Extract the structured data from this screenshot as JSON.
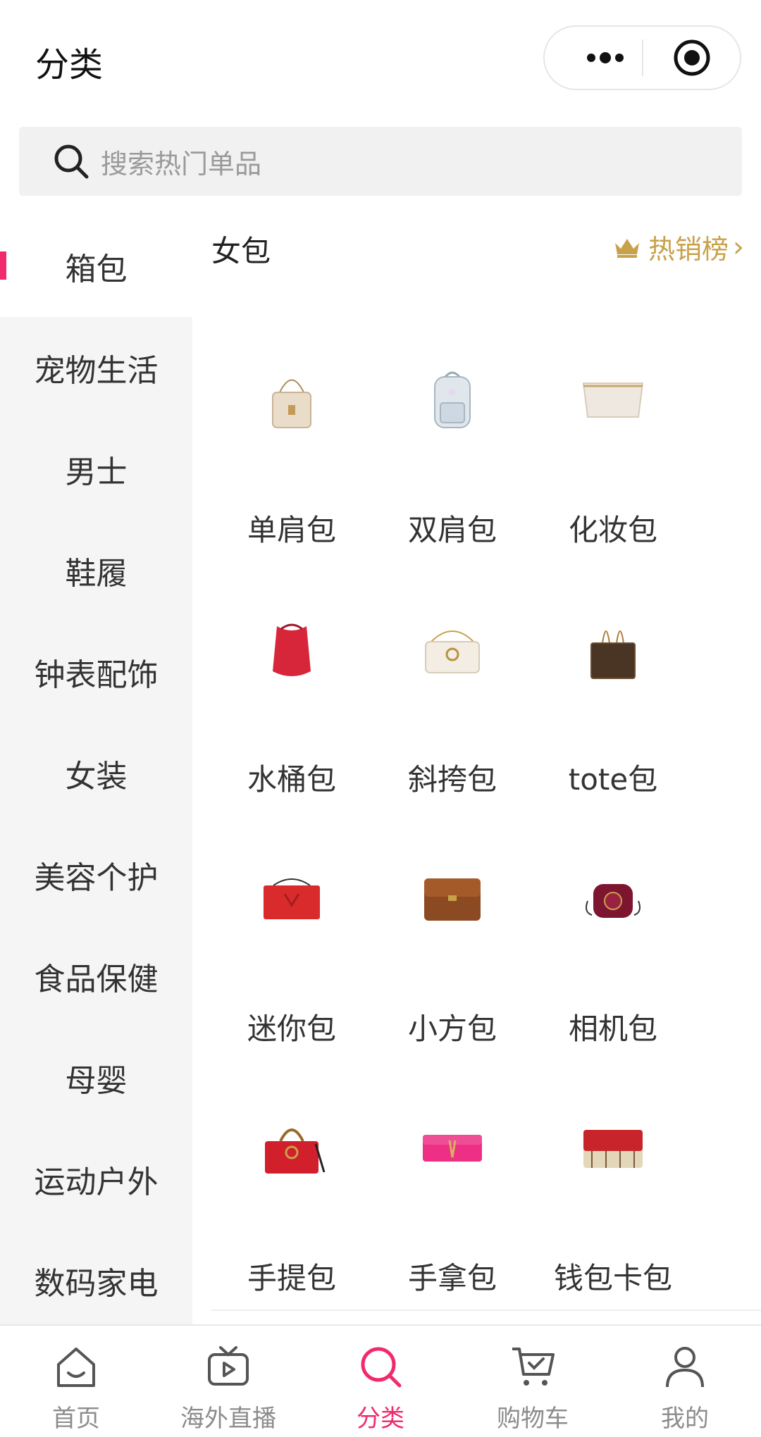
{
  "header": {
    "title": "分类"
  },
  "search": {
    "placeholder": "搜索热门单品"
  },
  "sidebar": {
    "items": [
      {
        "label": "箱包",
        "active": true
      },
      {
        "label": "宠物生活"
      },
      {
        "label": "男士"
      },
      {
        "label": "鞋履"
      },
      {
        "label": "钟表配饰"
      },
      {
        "label": "女装"
      },
      {
        "label": "美容个护"
      },
      {
        "label": "食品保健"
      },
      {
        "label": "母婴"
      },
      {
        "label": "运动户外"
      },
      {
        "label": "数码家电"
      }
    ]
  },
  "content": {
    "section_title": "女包",
    "hot_label": "热销榜",
    "categories": [
      {
        "label": "单肩包",
        "icon": "shoulder-bag"
      },
      {
        "label": "双肩包",
        "icon": "backpack"
      },
      {
        "label": "化妆包",
        "icon": "cosmetic-bag"
      },
      {
        "label": "水桶包",
        "icon": "bucket-bag"
      },
      {
        "label": "斜挎包",
        "icon": "crossbody-bag"
      },
      {
        "label": "tote包",
        "icon": "tote-bag"
      },
      {
        "label": "迷你包",
        "icon": "mini-bag"
      },
      {
        "label": "小方包",
        "icon": "box-bag"
      },
      {
        "label": "相机包",
        "icon": "camera-bag"
      },
      {
        "label": "手提包",
        "icon": "handbag"
      },
      {
        "label": "手拿包",
        "icon": "clutch"
      },
      {
        "label": "钱包卡包",
        "icon": "wallet"
      }
    ]
  },
  "tabbar": {
    "items": [
      {
        "label": "首页",
        "icon": "home-icon"
      },
      {
        "label": "海外直播",
        "icon": "live-tv-icon"
      },
      {
        "label": "分类",
        "icon": "search-icon",
        "active": true
      },
      {
        "label": "购物车",
        "icon": "cart-icon"
      },
      {
        "label": "我的",
        "icon": "user-icon"
      }
    ]
  },
  "colors": {
    "accent": "#f02a6b",
    "gold": "#c9a14a",
    "sidebar_bg": "#f5f5f5"
  }
}
